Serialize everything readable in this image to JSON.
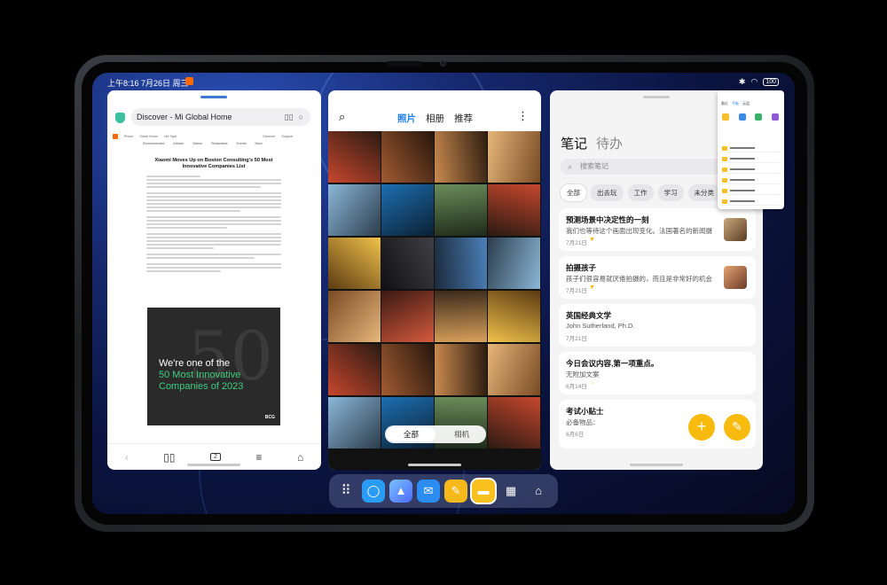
{
  "status_bar": {
    "time": "上午8:16 7月26日 周三",
    "battery": "100"
  },
  "browser": {
    "url_title": "Discover - Mi Global Home",
    "site_nav": [
      "Phone",
      "Smart Home",
      "Life Style",
      "Discover",
      "Support"
    ],
    "categories": [
      "Recommended",
      "Articles",
      "Videos",
      "Showcases",
      "Events",
      "More"
    ],
    "article_title": "Xiaomi Moves Up on Boston Consulting's 50 Most Innovative Companies List",
    "banner": {
      "line1": "We're one of the",
      "line2": "50 Most Innovative",
      "line3": "Companies of 2023",
      "big": "50",
      "brand": "BCG"
    },
    "tab_count": "2"
  },
  "gallery": {
    "tabs": [
      "照片",
      "相册",
      "推荐"
    ],
    "active_tab": "照片",
    "segment": [
      "全部",
      "相机"
    ]
  },
  "notes": {
    "tabs": [
      "笔记",
      "待办"
    ],
    "search_placeholder": "搜索笔记",
    "chips": [
      "全部",
      "出去玩",
      "工作",
      "学习",
      "未分类"
    ],
    "cards": [
      {
        "title": "预测场景中决定性的一刻",
        "body": "我们也等待这个画面出现变化。法国著名的新闻摄影",
        "date": "7月21日"
      },
      {
        "title": "拍摄孩子",
        "body": "孩子们很容易就厌倦拍摄的，而且是非常好的机会",
        "date": "7月21日"
      },
      {
        "title": "英国经典文学",
        "body": "John  Sutherland, Ph.D.",
        "date": "7月21日"
      },
      {
        "title": "今日会议内容,第一项重点。",
        "body": "无附加文案",
        "date": "6月14日"
      },
      {
        "title": "考试小贴士",
        "body": "必备物品：",
        "date": "6月6日"
      }
    ]
  },
  "mini_window": {
    "tabs": [
      "最近",
      "平板",
      "云盘"
    ]
  },
  "dock": {
    "apps": [
      "app-library",
      "messages",
      "gallery",
      "mail",
      "notes",
      "files",
      "grid-app",
      "home"
    ]
  },
  "colors": {
    "accent": "#1d7dfa",
    "notes_yellow": "#f8ba0d"
  }
}
